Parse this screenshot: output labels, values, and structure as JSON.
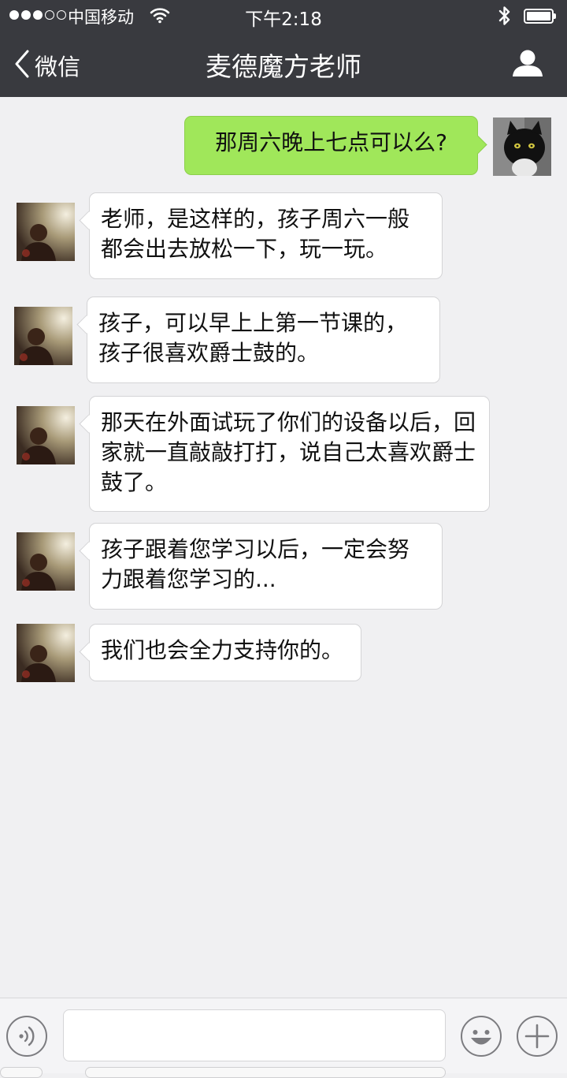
{
  "status_bar": {
    "carrier": "中国移动",
    "time": "下午2:18",
    "signal_dots_filled": 3,
    "signal_dots_total": 5,
    "wifi_icon": "wifi-icon",
    "bluetooth_icon": "bluetooth-icon",
    "battery_level": 1.0
  },
  "nav": {
    "back_label": "微信",
    "title": "麦德魔方老师",
    "profile_icon": "person-icon"
  },
  "messages": [
    {
      "side": "out",
      "avatar": "cat",
      "text": "那周六晚上七点可以么?"
    },
    {
      "side": "in",
      "avatar": "girl",
      "text": "老师，是这样的，孩子周六一般都会出去放松一下，玩一玩。"
    },
    {
      "side": "in",
      "avatar": "girl",
      "text": "孩子，可以早上上第一节课的，孩子很喜欢爵士鼓的。"
    },
    {
      "side": "in",
      "avatar": "girl",
      "text": "那天在外面试玩了你们的设备以后，回家就一直敲敲打打，说自己太喜欢爵士鼓了。"
    },
    {
      "side": "in",
      "avatar": "girl",
      "text": "孩子跟着您学习以后，一定会努力跟着您学习的..."
    },
    {
      "side": "in",
      "avatar": "girl",
      "text": "我们也会全力支持你的。"
    }
  ],
  "input_bar": {
    "value": "",
    "voice_icon": "voice-icon",
    "emoji_icon": "smiley-icon",
    "plus_icon": "plus-icon"
  },
  "colors": {
    "header_bg": "#393a3f",
    "chat_bg": "#f0f0f2",
    "outgoing_bubble": "#a0e75a",
    "incoming_bubble": "#ffffff"
  }
}
